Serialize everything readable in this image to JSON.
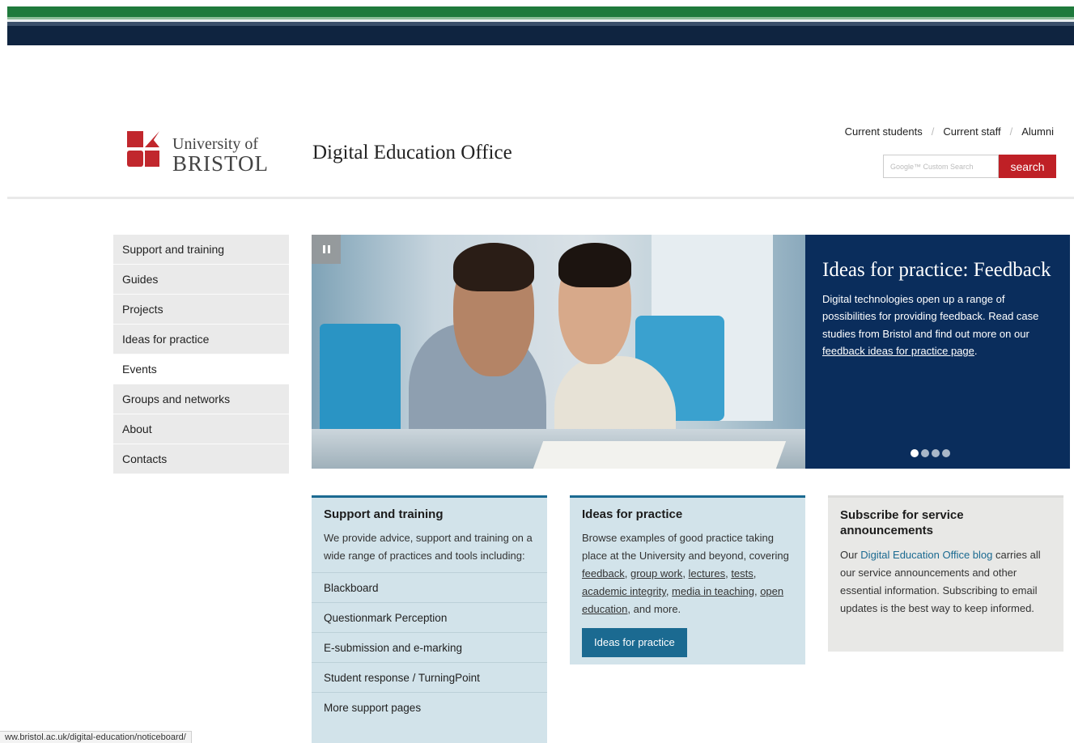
{
  "header": {
    "logo_line1": "University of",
    "logo_line2": "BRISTOL",
    "site_title": "Digital Education Office",
    "utility_links": [
      "Current students",
      "Current staff",
      "Alumni"
    ],
    "search_placeholder": "Google™ Custom Search",
    "search_button": "search"
  },
  "nav": {
    "items": [
      "Support and training",
      "Guides",
      "Projects",
      "Ideas for practice",
      "Events",
      "Groups and networks",
      "About",
      "Contacts"
    ],
    "active_index": 4
  },
  "hero": {
    "title": "Ideas for practice: Feedback",
    "text_before_link": "Digital technologies open up a range of possibilities for providing feedback. Read case studies from Bristol and find out more on our ",
    "link_text": "feedback ideas for practice page",
    "text_after_link": ".",
    "slides_total": 4,
    "current_slide": 1
  },
  "cards": {
    "support": {
      "title": "Support and training",
      "text": "We provide advice, support and training on a wide range of practices and tools including:",
      "links": [
        "Blackboard",
        "Questionmark Perception",
        "E-submission and e-marking",
        "Student response / TurningPoint",
        "More support pages"
      ]
    },
    "ideas": {
      "title": "Ideas for practice",
      "intro": "Browse examples of good practice taking place at the University and beyond, covering",
      "links": [
        "feedback",
        "group work",
        "lectures",
        "tests",
        "academic integrity",
        "media in teaching",
        "open education"
      ],
      "outro": "and more.",
      "button": "Ideas for practice"
    },
    "subscribe": {
      "title": "Subscribe for service announcements",
      "text_before": "Our ",
      "link": "Digital Education Office blog",
      "text_after": " carries all our service announcements and other essential information. Subscribing to email updates is the best way to keep informed."
    }
  },
  "status_bar": "ww.bristol.ac.uk/digital-education/noticeboard/",
  "colors": {
    "brand_red": "#bf2026",
    "navy": "#0a2d5c",
    "teal": "#1b6a91",
    "green": "#1f7a3c"
  }
}
